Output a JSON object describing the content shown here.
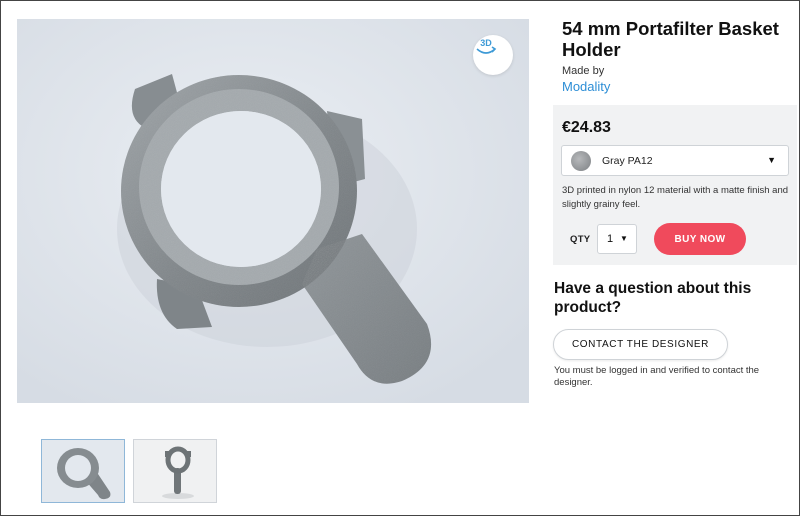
{
  "product": {
    "title": "54 mm Portafilter Basket Holder",
    "made_by_label": "Made by",
    "designer": "Modality"
  },
  "viewer": {
    "btn_3d_label": "3D",
    "btn_3d_icon": "rotate-3d-icon"
  },
  "purchase": {
    "price": "€24.83",
    "material": "Gray PA12",
    "material_swatch_color": "#9a9c9e",
    "material_description": "3D printed in nylon 12 material with a matte finish and slightly grainy feel.",
    "qty_label": "QTY",
    "qty_value": "1",
    "buy_label": "BUY NOW",
    "buy_color": "#f04a5c"
  },
  "contact": {
    "heading": "Have a question about this product?",
    "button_label": "CONTACT THE DESIGNER",
    "note": "You must be logged in and verified to contact the designer."
  },
  "thumbnails": [
    {
      "name": "top-view",
      "selected": true
    },
    {
      "name": "side-view",
      "selected": false
    }
  ]
}
